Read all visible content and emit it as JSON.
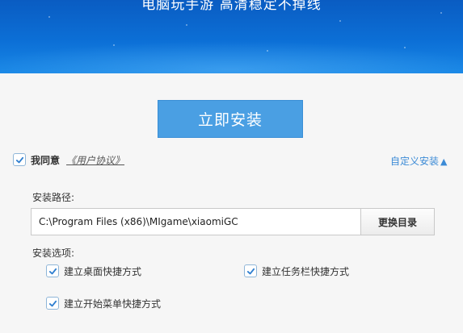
{
  "banner": {
    "title": "电脑玩手游 高清稳定不掉线"
  },
  "install_button": {
    "label": "立即安装"
  },
  "agreement": {
    "checked": true,
    "label": "我同意",
    "link": "《用户协议》"
  },
  "custom_install": {
    "label": "自定义安装",
    "arrow": "▲"
  },
  "install_path": {
    "label": "安装路径:",
    "value": "C:\\Program Files (x86)\\MIgame\\xiaomiGC",
    "browse_button": "更换目录"
  },
  "options": {
    "label": "安装选项:",
    "items": [
      {
        "label": "建立桌面快捷方式",
        "checked": true
      },
      {
        "label": "建立任务栏快捷方式",
        "checked": true
      },
      {
        "label": "建立开始菜单快捷方式",
        "checked": true
      }
    ]
  },
  "colors": {
    "accent": "#4a9fe3",
    "banner": "#0c6fd6",
    "link": "#3c8bd6",
    "check": "#2f7fd0"
  }
}
